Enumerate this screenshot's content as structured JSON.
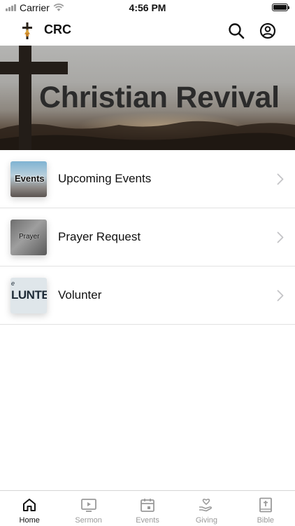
{
  "status_bar": {
    "carrier": "Carrier",
    "time": "4:56 PM",
    "battery_level": 1.0
  },
  "header": {
    "title": "CRC",
    "icons": [
      "cross-logo-icon",
      "search-icon",
      "account-icon"
    ]
  },
  "hero": {
    "title": "Christian Revival"
  },
  "menu": {
    "items": [
      {
        "label": "Upcoming Events",
        "thumb_text": "Events",
        "icon": "chevron-right-icon"
      },
      {
        "label": "Prayer Request",
        "thumb_text": "Prayer",
        "icon": "chevron-right-icon"
      },
      {
        "label": "Volunter",
        "thumb_text": "LUNTEE",
        "thumb_subtext": "e",
        "icon": "chevron-right-icon"
      }
    ]
  },
  "tab_bar": {
    "active": "Home",
    "tabs": [
      {
        "label": "Home",
        "icon": "home-icon"
      },
      {
        "label": "Sermon",
        "icon": "tv-play-icon"
      },
      {
        "label": "Events",
        "icon": "calendar-icon"
      },
      {
        "label": "Giving",
        "icon": "giving-hand-icon"
      },
      {
        "label": "Bible",
        "icon": "bible-icon"
      }
    ]
  },
  "colors": {
    "active_tab": "#111111",
    "inactive_tab": "#9a9a9a",
    "divider": "#e2e2e2"
  }
}
